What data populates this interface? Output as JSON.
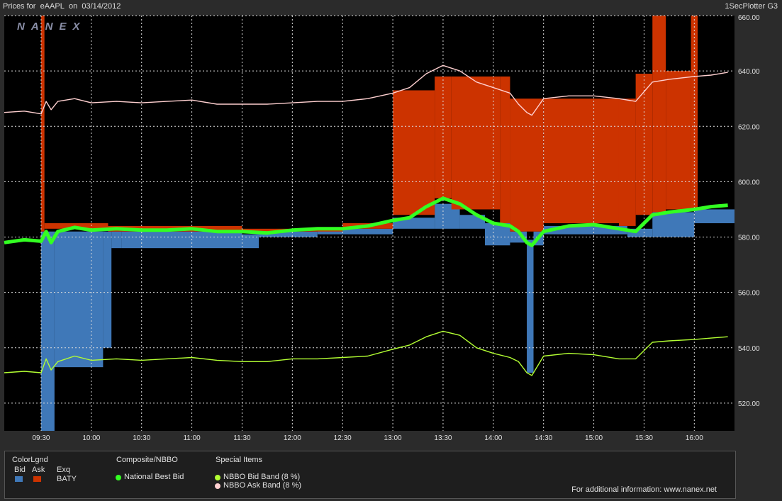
{
  "header": {
    "prices_for": "Prices for",
    "symbol": "eAAPL",
    "on_label": "on",
    "date": "03/14/2012",
    "plotter": "1SecPlotter G3"
  },
  "watermark": "NANEX",
  "legend": {
    "color_heading": "ColorLgnd",
    "bid_label": "Bid",
    "ask_label": "Ask",
    "exq_label": "Exq",
    "exchange": "BATY",
    "composite_heading": "Composite/NBBO",
    "national_best_bid": "National Best Bid",
    "special_heading": "Special Items",
    "bid_band": "NBBO Bid Band (8 %)",
    "ask_band": "NBBO Ask Band (8 %)",
    "info": "For additional information: www.nanex.net"
  },
  "colors": {
    "bid": "#3f78b8",
    "ask": "#cc3300",
    "nbbo": "#33ff22",
    "bid_band": "#b3ff33",
    "ask_band": "#ffd0d0",
    "grid": "#dddddd"
  },
  "chart_data": {
    "type": "line",
    "x_unit": "time",
    "ylim": [
      510,
      660
    ],
    "xlim": [
      "09:08",
      "16:24"
    ],
    "x_ticks": [
      "09:30",
      "10:00",
      "10:30",
      "11:00",
      "11:30",
      "12:00",
      "12:30",
      "13:00",
      "13:30",
      "14:00",
      "14:30",
      "15:00",
      "15:30",
      "16:00"
    ],
    "y_ticks": [
      "520.00",
      "540.00",
      "560.00",
      "580.00",
      "600.00",
      "620.00",
      "640.00",
      "660.00"
    ],
    "grid": true,
    "series": [
      {
        "name": "National Best Bid",
        "points": [
          [
            "09:08",
            578
          ],
          [
            "09:20",
            579
          ],
          [
            "09:30",
            578.5
          ],
          [
            "09:33",
            582
          ],
          [
            "09:36",
            578
          ],
          [
            "09:40",
            582
          ],
          [
            "09:50",
            583.5
          ],
          [
            "10:00",
            582.5
          ],
          [
            "10:15",
            583
          ],
          [
            "10:30",
            582.5
          ],
          [
            "10:45",
            582.5
          ],
          [
            "11:00",
            583
          ],
          [
            "11:15",
            582
          ],
          [
            "11:30",
            582
          ],
          [
            "11:45",
            581.5
          ],
          [
            "12:00",
            582.5
          ],
          [
            "12:15",
            583
          ],
          [
            "12:30",
            583
          ],
          [
            "12:45",
            584
          ],
          [
            "13:00",
            586
          ],
          [
            "13:10",
            587
          ],
          [
            "13:20",
            591
          ],
          [
            "13:30",
            594
          ],
          [
            "13:40",
            592
          ],
          [
            "13:50",
            588
          ],
          [
            "14:00",
            585
          ],
          [
            "14:10",
            584
          ],
          [
            "14:15",
            582
          ],
          [
            "14:20",
            578
          ],
          [
            "14:23",
            577
          ],
          [
            "14:30",
            582
          ],
          [
            "14:45",
            584
          ],
          [
            "15:00",
            584.5
          ],
          [
            "15:15",
            583
          ],
          [
            "15:25",
            582
          ],
          [
            "15:35",
            588
          ],
          [
            "15:45",
            589
          ],
          [
            "16:00",
            590
          ],
          [
            "16:10",
            591
          ],
          [
            "16:20",
            591.5
          ]
        ]
      },
      {
        "name": "NBBO Bid Band (8 %)",
        "points": [
          [
            "09:08",
            531
          ],
          [
            "09:20",
            531.5
          ],
          [
            "09:30",
            531
          ],
          [
            "09:33",
            536
          ],
          [
            "09:36",
            532
          ],
          [
            "09:40",
            535
          ],
          [
            "09:50",
            537
          ],
          [
            "10:00",
            535.5
          ],
          [
            "10:15",
            536
          ],
          [
            "10:30",
            535.5
          ],
          [
            "10:45",
            536
          ],
          [
            "11:00",
            536.5
          ],
          [
            "11:15",
            535.5
          ],
          [
            "11:30",
            535
          ],
          [
            "11:45",
            535
          ],
          [
            "12:00",
            536
          ],
          [
            "12:15",
            536
          ],
          [
            "12:30",
            536.5
          ],
          [
            "12:45",
            537
          ],
          [
            "13:00",
            539.5
          ],
          [
            "13:10",
            541
          ],
          [
            "13:20",
            544
          ],
          [
            "13:30",
            546
          ],
          [
            "13:40",
            544.5
          ],
          [
            "13:50",
            540
          ],
          [
            "14:00",
            538
          ],
          [
            "14:10",
            536.5
          ],
          [
            "14:15",
            535
          ],
          [
            "14:20",
            531
          ],
          [
            "14:23",
            530
          ],
          [
            "14:30",
            537
          ],
          [
            "14:45",
            538
          ],
          [
            "15:00",
            537.5
          ],
          [
            "15:15",
            536
          ],
          [
            "15:25",
            536
          ],
          [
            "15:35",
            542
          ],
          [
            "15:45",
            542.5
          ],
          [
            "16:00",
            543
          ],
          [
            "16:10",
            543.5
          ],
          [
            "16:20",
            544
          ]
        ]
      },
      {
        "name": "NBBO Ask Band (8 %)",
        "points": [
          [
            "09:08",
            625
          ],
          [
            "09:20",
            625.5
          ],
          [
            "09:30",
            624.5
          ],
          [
            "09:33",
            629
          ],
          [
            "09:36",
            626
          ],
          [
            "09:40",
            629
          ],
          [
            "09:50",
            630
          ],
          [
            "10:00",
            628.5
          ],
          [
            "10:15",
            629
          ],
          [
            "10:30",
            628.5
          ],
          [
            "10:45",
            629
          ],
          [
            "11:00",
            629.5
          ],
          [
            "11:15",
            628
          ],
          [
            "11:30",
            628
          ],
          [
            "11:45",
            628
          ],
          [
            "12:00",
            628.5
          ],
          [
            "12:15",
            629
          ],
          [
            "12:30",
            629
          ],
          [
            "12:45",
            630
          ],
          [
            "13:00",
            632
          ],
          [
            "13:10",
            634
          ],
          [
            "13:20",
            639
          ],
          [
            "13:30",
            642
          ],
          [
            "13:40",
            640
          ],
          [
            "13:50",
            636
          ],
          [
            "14:00",
            634
          ],
          [
            "14:10",
            632
          ],
          [
            "14:15",
            628
          ],
          [
            "14:20",
            625
          ],
          [
            "14:23",
            624
          ],
          [
            "14:30",
            630
          ],
          [
            "14:45",
            631
          ],
          [
            "15:00",
            631
          ],
          [
            "15:15",
            630
          ],
          [
            "15:25",
            629
          ],
          [
            "15:35",
            636
          ],
          [
            "15:45",
            637
          ],
          [
            "16:00",
            638
          ],
          [
            "16:10",
            638.5
          ],
          [
            "16:20",
            639.5
          ]
        ]
      }
    ],
    "bid_blocks": [
      {
        "x0": "09:30",
        "x1": "09:38",
        "low": 510,
        "high": 582
      },
      {
        "x0": "09:38",
        "x1": "10:07",
        "low": 533,
        "high": 582
      },
      {
        "x0": "10:07",
        "x1": "10:12",
        "low": 540,
        "high": 582
      },
      {
        "x0": "10:12",
        "x1": "10:18",
        "low": 576,
        "high": 582
      },
      {
        "x0": "10:18",
        "x1": "11:30",
        "low": 576,
        "high": 582
      },
      {
        "x0": "11:30",
        "x1": "11:40",
        "low": 576,
        "high": 581
      },
      {
        "x0": "11:40",
        "x1": "12:15",
        "low": 580,
        "high": 582
      },
      {
        "x0": "12:15",
        "x1": "13:00",
        "low": 581,
        "high": 583
      },
      {
        "x0": "13:00",
        "x1": "13:25",
        "low": 583,
        "high": 587
      },
      {
        "x0": "13:25",
        "x1": "13:40",
        "low": 583,
        "high": 592
      },
      {
        "x0": "13:40",
        "x1": "13:55",
        "low": 583,
        "high": 588
      },
      {
        "x0": "13:55",
        "x1": "14:10",
        "low": 577,
        "high": 585
      },
      {
        "x0": "14:10",
        "x1": "14:20",
        "low": 578,
        "high": 582
      },
      {
        "x0": "14:20",
        "x1": "14:24",
        "low": 531,
        "high": 579
      },
      {
        "x0": "14:24",
        "x1": "14:30",
        "low": 577,
        "high": 582
      },
      {
        "x0": "14:30",
        "x1": "15:20",
        "low": 581,
        "high": 584
      },
      {
        "x0": "15:20",
        "x1": "15:35",
        "low": 580,
        "high": 583
      },
      {
        "x0": "15:35",
        "x1": "16:00",
        "low": 580,
        "high": 589
      },
      {
        "x0": "16:00",
        "x1": "16:24",
        "low": 585,
        "high": 590
      }
    ],
    "ask_blocks": [
      {
        "x0": "09:30",
        "x1": "09:32",
        "low": 582,
        "high": 660
      },
      {
        "x0": "09:32",
        "x1": "10:10",
        "low": 583,
        "high": 585
      },
      {
        "x0": "10:10",
        "x1": "11:30",
        "low": 582,
        "high": 584
      },
      {
        "x0": "11:30",
        "x1": "12:30",
        "low": 582,
        "high": 583
      },
      {
        "x0": "12:30",
        "x1": "13:00",
        "low": 583,
        "high": 585
      },
      {
        "x0": "13:00",
        "x1": "13:25",
        "low": 588,
        "high": 633
      },
      {
        "x0": "13:25",
        "x1": "13:35",
        "low": 594,
        "high": 638
      },
      {
        "x0": "13:35",
        "x1": "14:04",
        "low": 590,
        "high": 638
      },
      {
        "x0": "14:04",
        "x1": "14:10",
        "low": 585,
        "high": 638
      },
      {
        "x0": "14:10",
        "x1": "14:30",
        "low": 582,
        "high": 630
      },
      {
        "x0": "14:30",
        "x1": "15:15",
        "low": 585,
        "high": 630
      },
      {
        "x0": "15:15",
        "x1": "15:25",
        "low": 584,
        "high": 630
      },
      {
        "x0": "15:25",
        "x1": "15:35",
        "low": 588,
        "high": 639
      },
      {
        "x0": "15:35",
        "x1": "15:43",
        "low": 589,
        "high": 660
      },
      {
        "x0": "15:43",
        "x1": "15:58",
        "low": 590,
        "high": 640
      },
      {
        "x0": "15:58",
        "x1": "16:02",
        "low": 590,
        "high": 660
      }
    ]
  }
}
